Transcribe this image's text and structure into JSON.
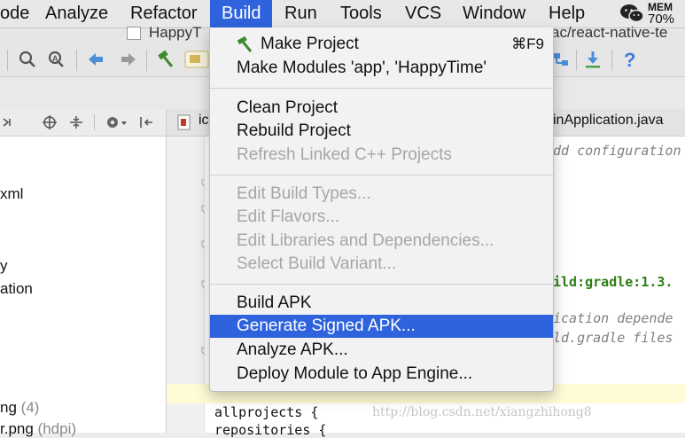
{
  "menubar": {
    "items": [
      "ode",
      "Analyze",
      "Refactor",
      "Build",
      "Run",
      "Tools",
      "VCS",
      "Window",
      "Help"
    ],
    "mem_label": "MEM",
    "mem_value": "70%"
  },
  "window": {
    "title_left": "HappyT",
    "title_right": "ac/react-native-te"
  },
  "tabs": {
    "first": "ic",
    "second": "inApplication.java"
  },
  "tree": {
    "items": [
      "xml",
      "y",
      "ation",
      "ng",
      "(4)",
      "r.png",
      "(hdpi)"
    ]
  },
  "code": {
    "line1": "dd configuration",
    "line2": "ild:gradle:1.3.",
    "line3": "ication depende",
    "line4": "ld.gradle files",
    "line5": "allprojects {",
    "line6": "    repositories {"
  },
  "build_menu": {
    "make_project": "Make Project",
    "make_project_shortcut": "⌘F9",
    "make_modules": "Make Modules 'app', 'HappyTime'",
    "clean_project": "Clean Project",
    "rebuild_project": "Rebuild Project",
    "refresh_linked": "Refresh Linked C++ Projects",
    "edit_build_types": "Edit Build Types...",
    "edit_flavors": "Edit Flavors...",
    "edit_libraries": "Edit Libraries and Dependencies...",
    "select_variant": "Select Build Variant...",
    "build_apk": "Build APK",
    "generate_signed_apk": "Generate Signed APK...",
    "analyze_apk": "Analyze APK...",
    "deploy_module": "Deploy Module to App Engine..."
  },
  "watermark": "http://blog.csdn.net/xiangzhihong8",
  "colors": {
    "menu_highlight": "#2f63dd",
    "disabled_text": "#a6a6a6",
    "code_green": "#2e7d15"
  }
}
